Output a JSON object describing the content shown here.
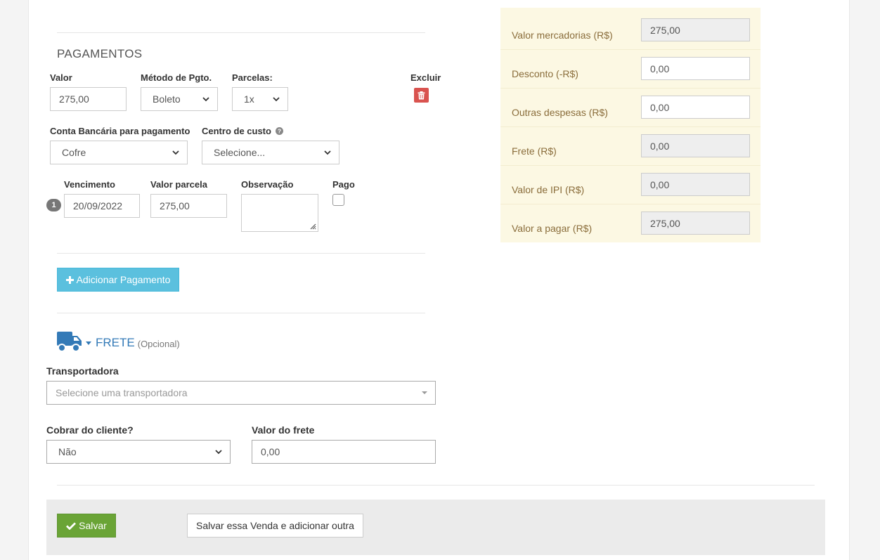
{
  "pagamentos": {
    "title": "PAGAMENTOS",
    "valor_label": "Valor",
    "valor_value": "275,00",
    "metodo_label": "Método de Pgto.",
    "metodo_value": "Boleto",
    "parcelas_label": "Parcelas:",
    "parcelas_value": "1x",
    "excluir_label": "Excluir",
    "conta_label": "Conta Bancária para pagamento",
    "conta_value": "Cofre",
    "centro_label": "Centro de custo",
    "centro_value": "Selecione...",
    "parcela": {
      "index": "1",
      "vencimento_label": "Vencimento",
      "vencimento_value": "20/09/2022",
      "valor_label": "Valor parcela",
      "valor_value": "275,00",
      "observacao_label": "Observação",
      "pago_label": "Pago"
    },
    "add_button": "Adicionar Pagamento"
  },
  "frete": {
    "title": "FRETE",
    "optional": "(Opcional)",
    "transportadora_label": "Transportadora",
    "transportadora_placeholder": "Selecione uma transportadora",
    "cobrar_label": "Cobrar do cliente?",
    "cobrar_value": "Não",
    "valor_label": "Valor do frete",
    "valor_value": "0,00"
  },
  "summary": [
    {
      "label": "Valor mercadorias (R$)",
      "value": "275,00",
      "readonly": true
    },
    {
      "label": "Desconto (-R$)",
      "value": "0,00",
      "readonly": false
    },
    {
      "label": "Outras despesas (R$)",
      "value": "0,00",
      "readonly": false
    },
    {
      "label": "Frete (R$)",
      "value": "0,00",
      "readonly": true
    },
    {
      "label": "Valor de IPI (R$)",
      "value": "0,00",
      "readonly": true
    },
    {
      "label": "Valor a pagar (R$)",
      "value": "275,00",
      "readonly": true
    }
  ],
  "footer": {
    "save_button": "Salvar",
    "save_another_button": "Salvar essa Venda e adicionar outra"
  },
  "colors": {
    "info": "#5bc0de",
    "success": "#6aa436",
    "danger": "#d9534f",
    "summary_bg": "#fcf8e3",
    "truck": "#337ab7"
  },
  "icons": {
    "trash": "trash-icon",
    "help": "question-circle-icon",
    "plus": "plus-icon",
    "truck": "truck-icon",
    "caret": "caret-down-icon",
    "check": "check-icon"
  }
}
